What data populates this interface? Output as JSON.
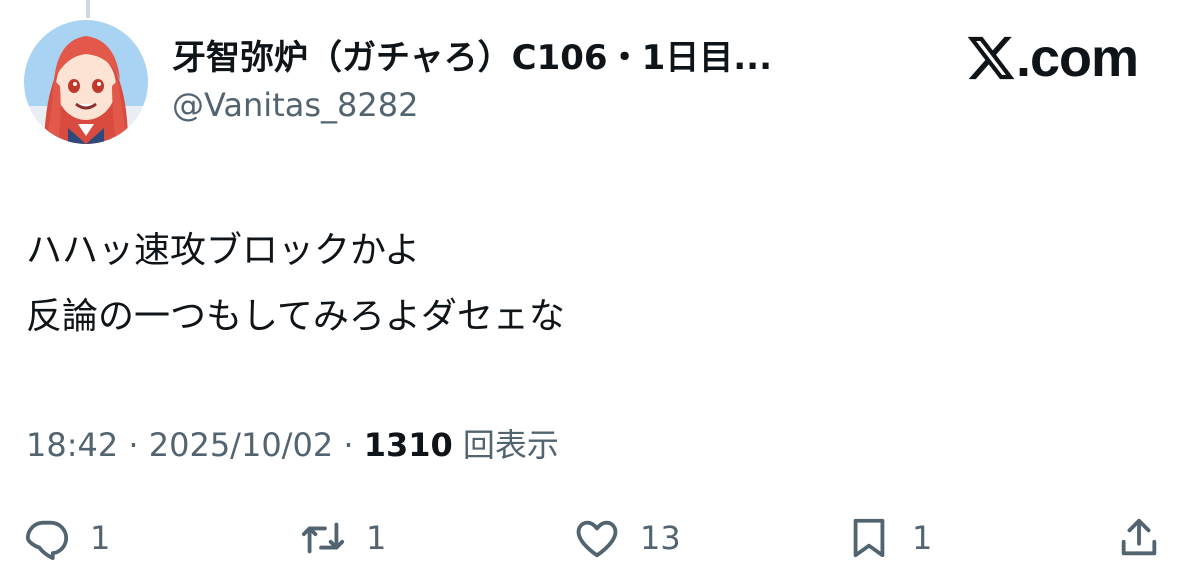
{
  "tweet": {
    "display_name": "牙智弥炉（ガチャろ）C106・1日目...",
    "handle": "@Vanitas_8282",
    "brand": ".com",
    "text_lines": [
      "ハハッ速攻ブロックかよ",
      "反論の一つもしてみろよダセェな"
    ],
    "time": "18:42",
    "sep": " · ",
    "date": "2025/10/02",
    "views_count": "1310",
    "views_label": "回表示"
  },
  "actions": {
    "reply_count": "1",
    "repost_count": "1",
    "like_count": "13",
    "bookmark_count": "1"
  },
  "colors": {
    "text": "#0f1419",
    "secondary": "#536471",
    "avatar_hair": "#e2584a"
  },
  "icons": [
    "x-logo-icon",
    "reply-icon",
    "repost-icon",
    "like-icon",
    "bookmark-icon",
    "share-icon"
  ]
}
